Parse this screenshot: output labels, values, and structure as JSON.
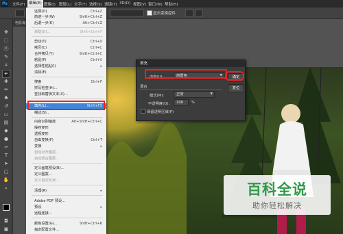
{
  "app": {
    "logo": "Ps"
  },
  "menubar": {
    "items": [
      "文件(F)",
      "编辑(E)",
      "图像(I)",
      "图层(L)",
      "文字(Y)",
      "选择(S)",
      "滤镜(T)",
      "3D(D)",
      "视图(V)",
      "窗口(W)",
      "帮助(H)"
    ]
  },
  "options_bar": {
    "show_transform_controls": "显示变换控件"
  },
  "document_tab": {
    "label": "电影海报.jpg @ 33.3%"
  },
  "toolbar": {
    "tools": [
      "move-icon",
      "marquee-icon",
      "lasso-icon",
      "quick-select-icon",
      "crop-icon",
      "eyedropper-icon",
      "healing-icon",
      "brush-icon",
      "stamp-icon",
      "history-brush-icon",
      "eraser-icon",
      "gradient-icon",
      "blur-icon",
      "dodge-icon",
      "pen-icon",
      "type-icon",
      "path-select-icon",
      "shape-icon",
      "hand-icon",
      "zoom-icon"
    ],
    "selected_index": 5
  },
  "edit_menu": {
    "items": [
      {
        "label": "还原(O)",
        "shortcut": "Ctrl+Z"
      },
      {
        "label": "前进一步(W)",
        "shortcut": "Shift+Ctrl+Z"
      },
      {
        "label": "后退一步(K)",
        "shortcut": "Alt+Ctrl+Z"
      },
      {
        "label": "渐隐(D)...",
        "shortcut": "Shift+Ctrl+F"
      },
      {
        "label": "剪切(T)",
        "shortcut": "Ctrl+X"
      },
      {
        "label": "拷贝(C)",
        "shortcut": "Ctrl+C"
      },
      {
        "label": "合并拷贝(Y)",
        "shortcut": "Shift+Ctrl+C"
      },
      {
        "label": "粘贴(P)",
        "shortcut": "Ctrl+V"
      },
      {
        "label": "选择性粘贴(I)",
        "shortcut": ""
      },
      {
        "label": "清除(E)",
        "shortcut": ""
      },
      {
        "label": "搜索",
        "shortcut": "Ctrl+F"
      },
      {
        "label": "拼写检查(H)...",
        "shortcut": ""
      },
      {
        "label": "查找和替换文本(X)...",
        "shortcut": ""
      },
      {
        "label": "填充(L)...",
        "shortcut": "Shift+F5"
      },
      {
        "label": "描边(S)...",
        "shortcut": ""
      },
      {
        "label": "内容识别缩放",
        "shortcut": "Alt+Shift+Ctrl+C"
      },
      {
        "label": "操控变形",
        "shortcut": ""
      },
      {
        "label": "透视变形",
        "shortcut": ""
      },
      {
        "label": "自由变换(F)",
        "shortcut": "Ctrl+T"
      },
      {
        "label": "变换",
        "shortcut": ""
      },
      {
        "label": "自动对齐图层...",
        "shortcut": ""
      },
      {
        "label": "自动混合图层...",
        "shortcut": ""
      },
      {
        "label": "定义画笔预设(B)...",
        "shortcut": ""
      },
      {
        "label": "定义图案...",
        "shortcut": ""
      },
      {
        "label": "定义自定形状...",
        "shortcut": ""
      },
      {
        "label": "清理(R)",
        "shortcut": ""
      },
      {
        "label": "Adobe PDF 预设...",
        "shortcut": ""
      },
      {
        "label": "预设",
        "shortcut": ""
      },
      {
        "label": "远程连接...",
        "shortcut": ""
      },
      {
        "label": "颜色设置(G)...",
        "shortcut": "Shift+Ctrl+K"
      },
      {
        "label": "指定配置文件...",
        "shortcut": ""
      }
    ]
  },
  "fill_dialog": {
    "title": "填充",
    "contents_label": "内容(U):",
    "contents_value": "前景色",
    "blending_label": "混合",
    "mode_label": "模式(M):",
    "mode_value": "正常",
    "opacity_label": "不透明度(O):",
    "opacity_value": "100",
    "opacity_unit": "%",
    "preserve_label": "保留透明区域(P)",
    "ok_label": "确定",
    "reset_label": "复位"
  },
  "watermark": {
    "title": "百科全说",
    "subtitle": "助你轻松解决"
  }
}
